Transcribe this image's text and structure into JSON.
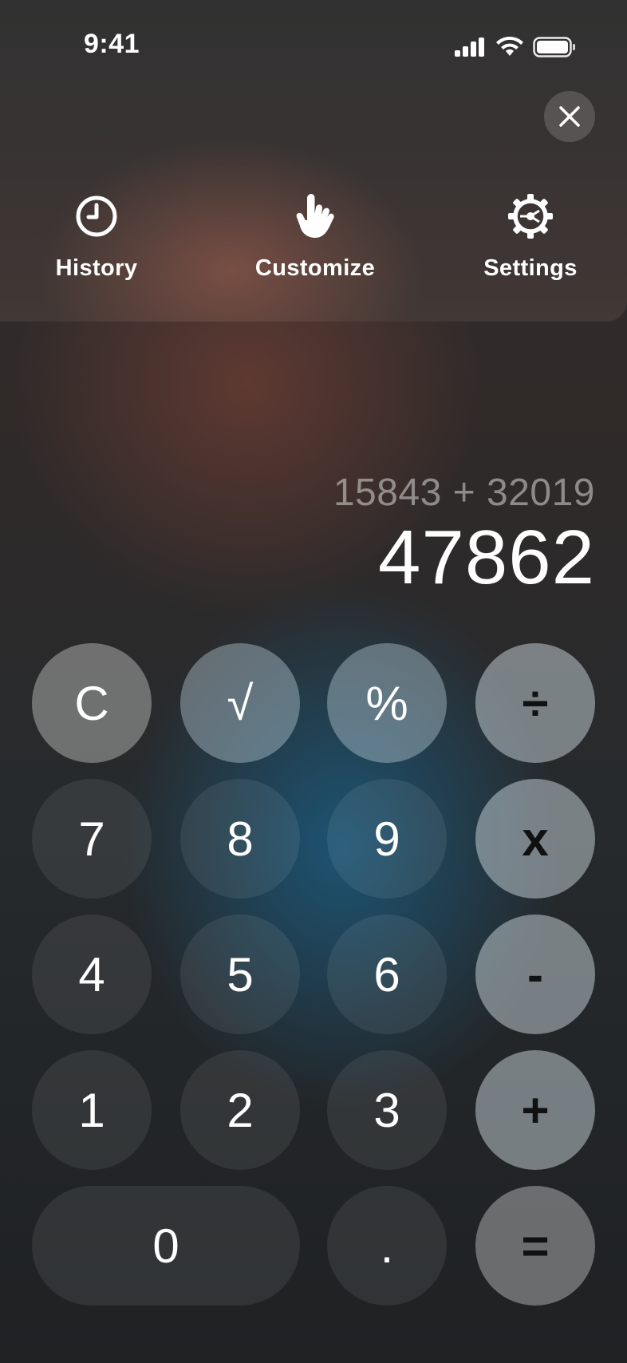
{
  "status_bar": {
    "time": "9:41",
    "icons": [
      "signal-icon",
      "wifi-icon",
      "battery-icon"
    ]
  },
  "top_menu": {
    "close_icon": "close-icon",
    "items": [
      {
        "label": "History",
        "icon": "clock-icon"
      },
      {
        "label": "Customize",
        "icon": "hand-pointer-icon"
      },
      {
        "label": "Settings",
        "icon": "gear-icon"
      }
    ]
  },
  "display": {
    "expression": "15843 + 32019",
    "result": "47862"
  },
  "keypad": {
    "clear": "C",
    "sqrt": "√",
    "percent": "%",
    "divide": "÷",
    "seven": "7",
    "eight": "8",
    "nine": "9",
    "multiply": "x",
    "four": "4",
    "five": "5",
    "six": "6",
    "minus": "-",
    "one": "1",
    "two": "2",
    "three": "3",
    "plus": "+",
    "zero": "0",
    "decimal": ".",
    "equals": "="
  },
  "colors": {
    "accent_warm": "#6e3e34",
    "accent_cool": "#1c5676",
    "operator_key": "#bcc8cd"
  }
}
